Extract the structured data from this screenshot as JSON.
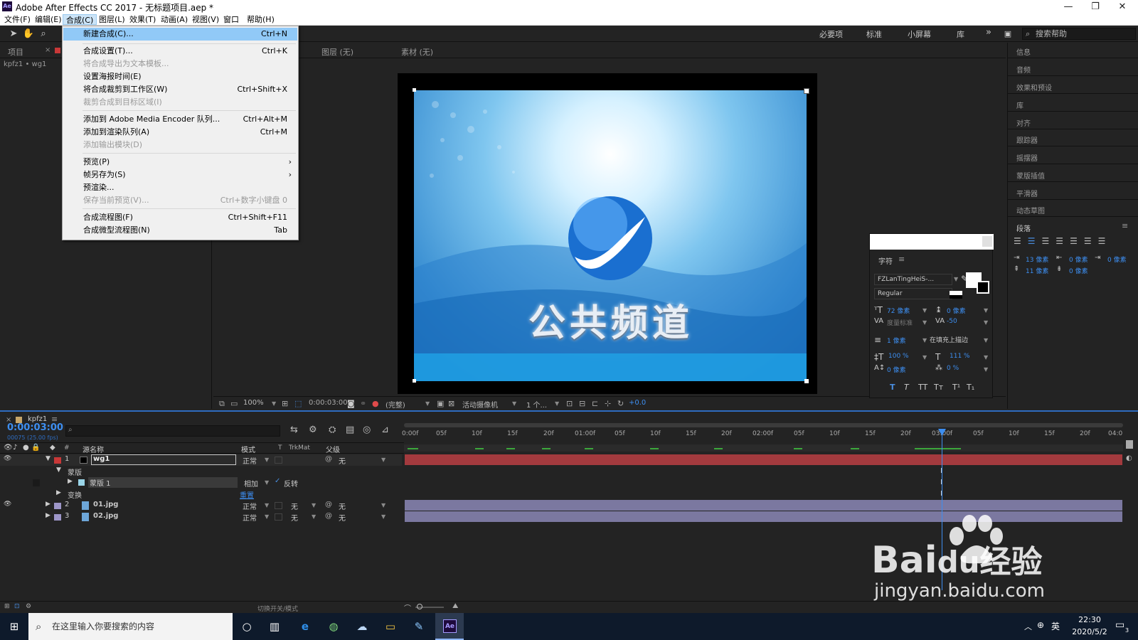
{
  "app": {
    "title": "Adobe After Effects CC 2017 - 无标题项目.aep *",
    "logo_text": "Ae"
  },
  "window_controls": {
    "minimize": "—",
    "maximize": "❐",
    "close": "✕"
  },
  "menubar": {
    "items": [
      "文件(F)",
      "编辑(E)",
      "合成(C)",
      "图层(L)",
      "效果(T)",
      "动画(A)",
      "视图(V)",
      "窗口",
      "帮助(H)"
    ]
  },
  "workspaces": [
    "必要项",
    "标准",
    "小屏幕",
    "库"
  ],
  "workspace_more": "»",
  "help_search": {
    "placeholder": "搜索帮助"
  },
  "composition_menu": {
    "items": [
      {
        "label": "新建合成(C)...",
        "shortcut": "Ctrl+N",
        "state": "highlight"
      },
      {
        "label": "合成设置(T)...",
        "shortcut": "Ctrl+K",
        "state": "normal"
      },
      {
        "label": "将合成导出为文本模板...",
        "shortcut": "",
        "state": "disabled"
      },
      {
        "label": "设置海报时间(E)",
        "shortcut": "",
        "state": "normal"
      },
      {
        "label": "将合成裁剪到工作区(W)",
        "shortcut": "Ctrl+Shift+X",
        "state": "normal"
      },
      {
        "label": "裁剪合成到目标区域(I)",
        "shortcut": "",
        "state": "disabled"
      },
      {
        "label": "添加到 Adobe Media Encoder 队列...",
        "shortcut": "Ctrl+Alt+M",
        "state": "normal"
      },
      {
        "label": "添加到渲染队列(A)",
        "shortcut": "Ctrl+M",
        "state": "normal"
      },
      {
        "label": "添加输出模块(D)",
        "shortcut": "",
        "state": "disabled"
      },
      {
        "label": "预览(P)",
        "shortcut": "›",
        "state": "normal"
      },
      {
        "label": "帧另存为(S)",
        "shortcut": "›",
        "state": "normal"
      },
      {
        "label": "预渲染...",
        "shortcut": "",
        "state": "normal"
      },
      {
        "label": "保存当前预览(V)...",
        "shortcut": "Ctrl+数字小键盘 0",
        "state": "disabled"
      },
      {
        "label": "合成流程图(F)",
        "shortcut": "Ctrl+Shift+F11",
        "state": "normal"
      },
      {
        "label": "合成微型流程图(N)",
        "shortcut": "Tab",
        "state": "normal"
      }
    ]
  },
  "project_panel": {
    "tab": "项目",
    "breadcrumb": "kpfz1 • wg1"
  },
  "viewer_tabs": {
    "layer": "图层 (无)",
    "footage": "素材 (无)"
  },
  "comp_image": {
    "title_text": "公共频道"
  },
  "viewer_controls": {
    "zoom": "100%",
    "timecode": "0:00:03:00",
    "resolution": "(完整)",
    "camera": "活动摄像机",
    "views": "1 个...",
    "exposure": "+0.0"
  },
  "right_panels": {
    "items": [
      "信息",
      "音频",
      "效果和预设",
      "库",
      "对齐",
      "跟踪器",
      "摇摆器",
      "蒙版插值",
      "平滑器",
      "动态草图"
    ],
    "paragraph_title": "段落",
    "indent_left": "13 像素",
    "indent_right": "0 像素",
    "indent_first": "0 像素",
    "space_before": "11 像素",
    "space_after": "0 像素"
  },
  "character_panel": {
    "title": "字符",
    "font": "FZLanTingHeiS-...",
    "style": "Regular",
    "font_size": "72 像素",
    "leading": "0 像素",
    "kerning": "度量标准",
    "tracking": "-50",
    "stroke_width": "1 像素",
    "stroke_type": "在填充上描边",
    "vert_scale": "100 %",
    "horiz_scale": "111 %",
    "baseline_shift": "0 像素",
    "tsume": "0 %",
    "style_buttons": [
      "T",
      "T",
      "TT",
      "Tт",
      "T¹",
      "T₁"
    ]
  },
  "timeline": {
    "comp_tab": "kpfz1",
    "timecode": "0:00:03:00",
    "frame_info": "00075 (25.00 fps)",
    "search_placeholder": "",
    "columns": {
      "name": "源名称",
      "mode": "模式",
      "t": "T",
      "trkmat": "TrkMat",
      "parent": "父级"
    },
    "layers": [
      {
        "num": "1",
        "name": "wg1",
        "mode": "正常",
        "trkmat": "",
        "parent": "无",
        "color": "#c83838"
      },
      {
        "num": "2",
        "name": "01.jpg",
        "mode": "正常",
        "trkmat": "无",
        "parent": "无",
        "color": "#9d96c8"
      },
      {
        "num": "3",
        "name": "02.jpg",
        "mode": "正常",
        "trkmat": "无",
        "parent": "无",
        "color": "#9d96c8"
      }
    ],
    "mask_group": "蒙版",
    "mask_name": "蒙版 1",
    "mask_mode": "相加",
    "mask_invert": "反转",
    "transform": "变换",
    "reset": "重置",
    "ruler_labels": [
      "0:00f",
      "05f",
      "10f",
      "15f",
      "20f",
      "01:00f",
      "05f",
      "10f",
      "15f",
      "20f",
      "02:00f",
      "05f",
      "10f",
      "15f",
      "20f",
      "03:00f",
      "05f",
      "10f",
      "15f",
      "20f",
      "04:0"
    ],
    "footer_label": "切换开关/模式"
  },
  "watermark": {
    "brand": "Bai",
    "brand2": "du",
    "brand_cn": "经验",
    "url": "jingyan.baidu.com"
  },
  "taskbar": {
    "search_placeholder": "在这里输入你要搜索的内容",
    "lang": "英",
    "time": "22:30",
    "date": "2020/5/2",
    "notification_count": "3"
  },
  "colors": {
    "accent_blue": "#2e6cc0",
    "menu_highlight": "#91c9f7",
    "layer_red": "#c83838",
    "layer_lavender": "#9d96c8",
    "timecode_blue": "#3d8ef0"
  }
}
